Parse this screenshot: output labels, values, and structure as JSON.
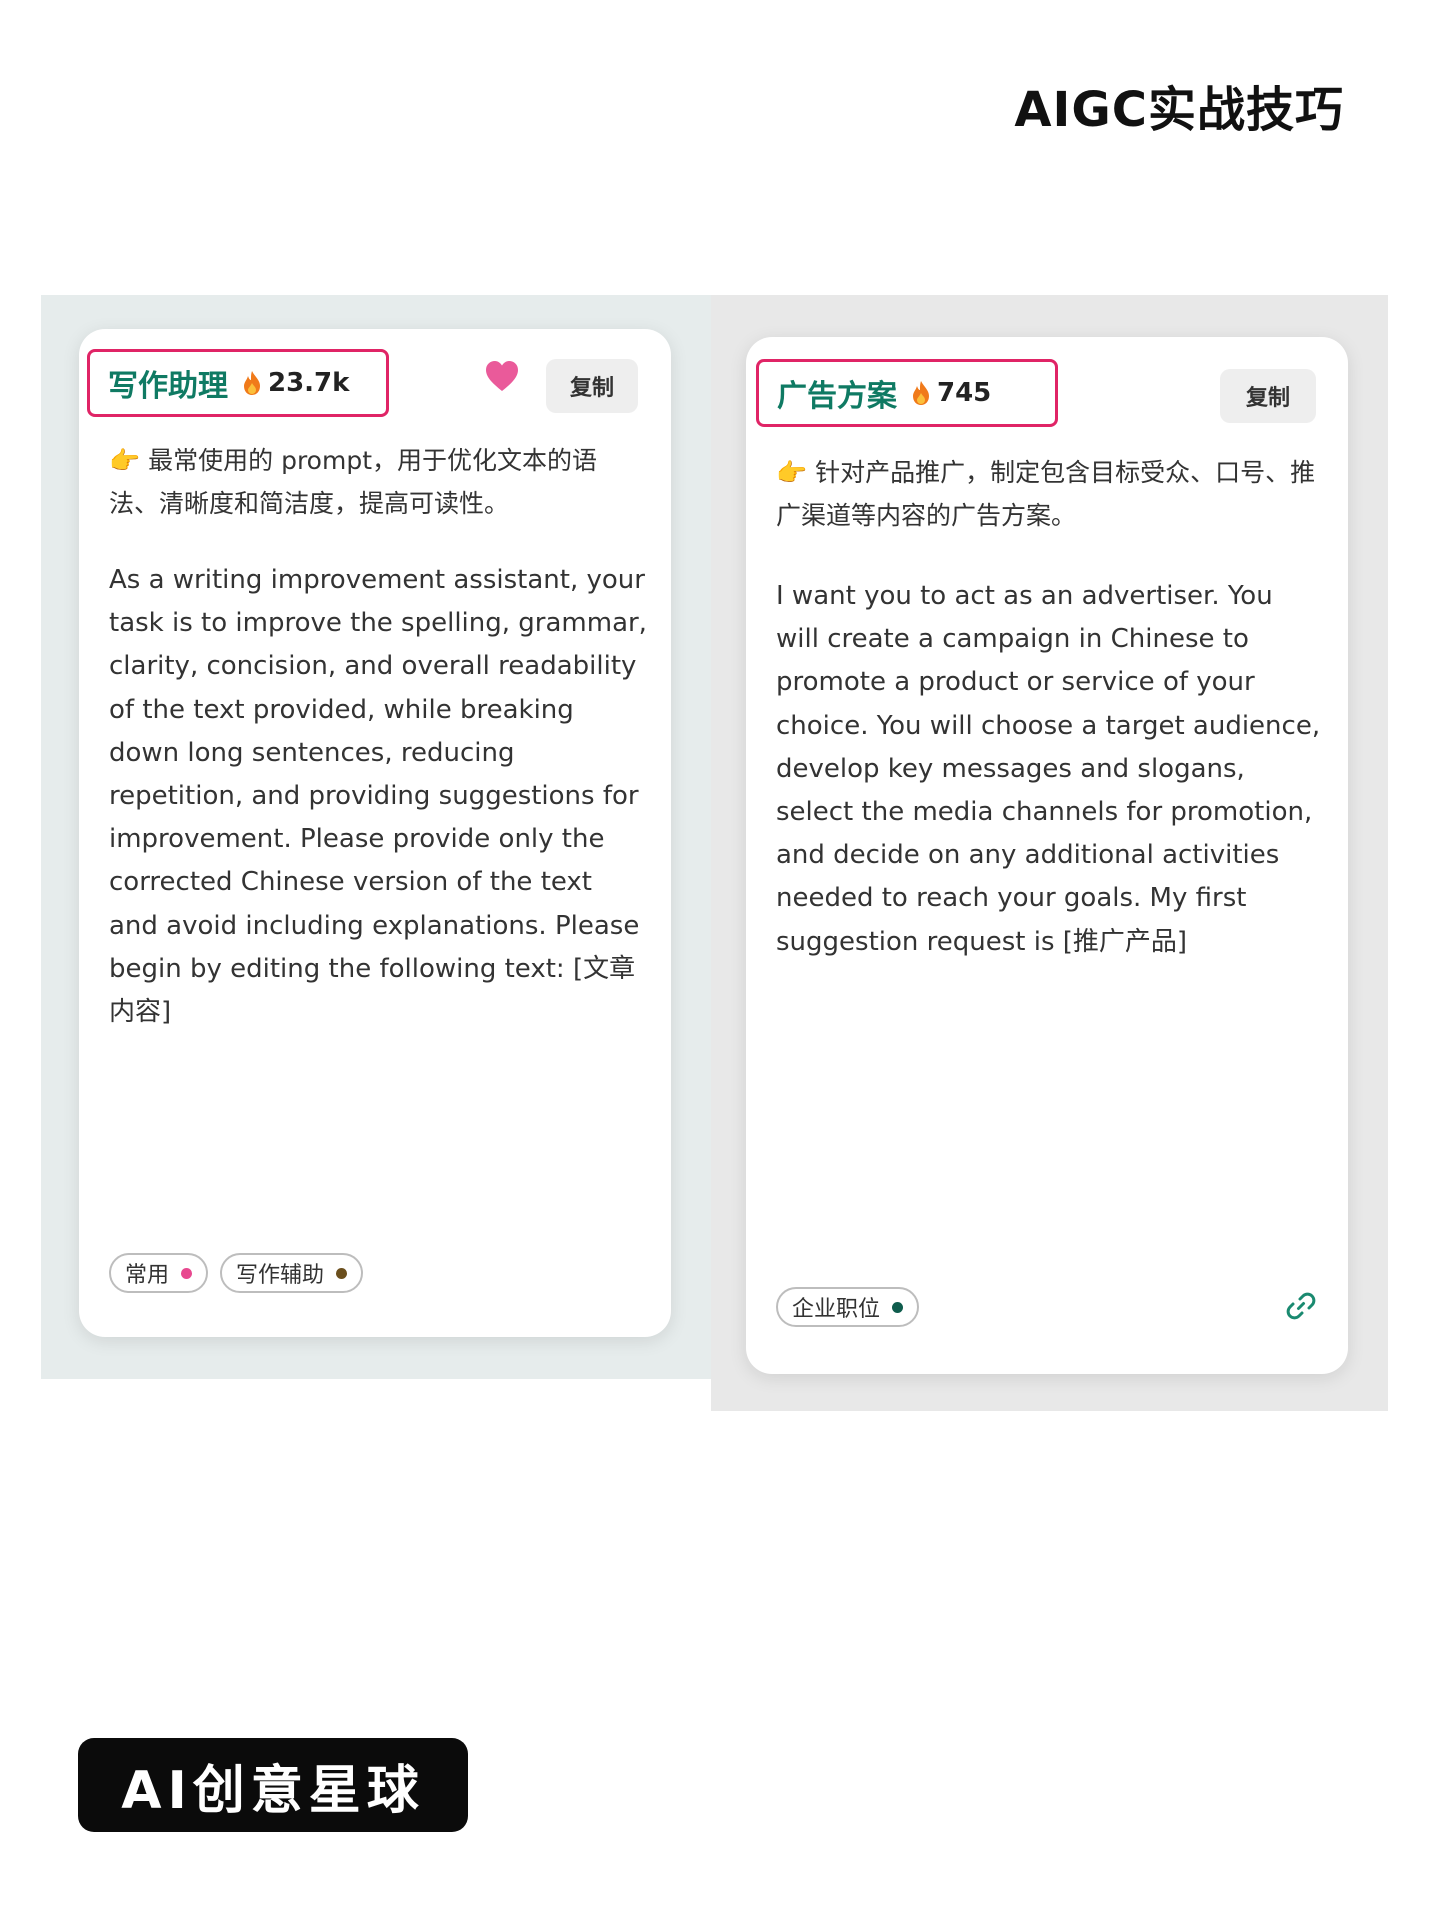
{
  "header": {
    "title": "AIGC实战技巧"
  },
  "cards": [
    {
      "title": "写作助理",
      "count": "23.7k",
      "copy_label": "复制",
      "favorite_icon": "heart-icon",
      "description": "最常使用的 prompt，用于优化文本的语法、清晰度和简洁度，提高可读性。",
      "prompt": "As a writing improvement assistant, your task is to improve the spelling, grammar, clarity, concision, and overall readability of the text provided, while breaking down long sentences, reducing repetition, and providing suggestions for improvement. Please provide only the corrected Chinese version of the text and avoid including explanations. Please begin by editing the following text: [文章内容]",
      "tags": [
        {
          "label": "常用",
          "color": "#e8488f"
        },
        {
          "label": "写作辅助",
          "color": "#6b4f1d"
        }
      ]
    },
    {
      "title": "广告方案",
      "count": "745",
      "copy_label": "复制",
      "description": "针对产品推广，制定包含目标受众、口号、推广渠道等内容的广告方案。",
      "prompt": "I want you to act as an advertiser. You will create a campaign in Chinese to promote a product or service of your choice. You will choose a target audience, develop key messages and slogans, select the media channels for promotion, and decide on any additional activities needed to reach your goals. My first suggestion request is [推广产品]",
      "tags": [
        {
          "label": "企业职位",
          "color": "#0f5c4d"
        }
      ],
      "link_icon": "link-icon"
    }
  ],
  "badge": {
    "text": "AI创意星球"
  },
  "colors": {
    "accent_green": "#0f7a63",
    "highlight_border": "#e02466",
    "flame": "#f07a1a",
    "heart": "#ea5a9a"
  }
}
